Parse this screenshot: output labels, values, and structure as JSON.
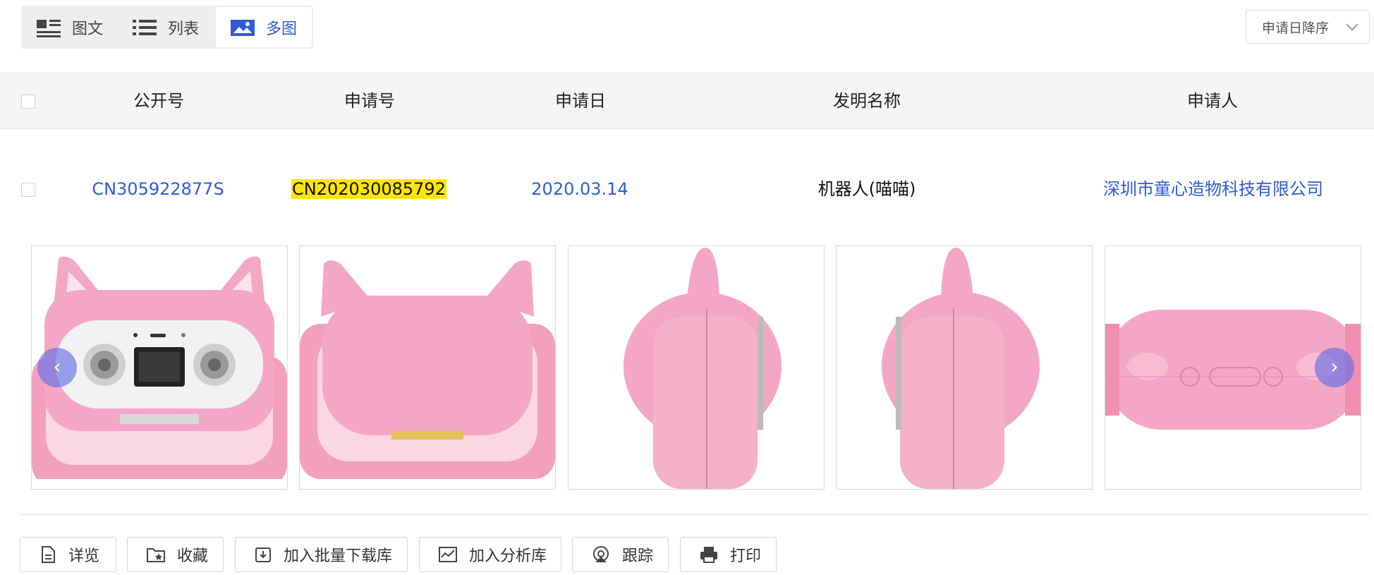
{
  "view_toggle": {
    "items": [
      {
        "label": "图文",
        "icon": "image-text-icon"
      },
      {
        "label": "列表",
        "icon": "list-icon"
      },
      {
        "label": "多图",
        "icon": "multi-image-icon",
        "active": true
      }
    ]
  },
  "sort": {
    "label": "申请日降序"
  },
  "table": {
    "headers": [
      "公开号",
      "申请号",
      "申请日",
      "发明名称",
      "申请人"
    ],
    "row": {
      "publication_no": "CN305922877S",
      "application_no": "CN202030085792",
      "application_date": "2020.03.14",
      "title": "机器人(喵喵)",
      "applicant": "深圳市童心造物科技有限公司"
    }
  },
  "images": {
    "count": 5,
    "descriptions": [
      "front view",
      "rear view",
      "left view",
      "right view",
      "top view"
    ],
    "colors": {
      "body": "#f4a7c4",
      "face": "#f2f2f2",
      "screen": "#222222"
    }
  },
  "actions": [
    {
      "label": "详览",
      "icon": "document-icon"
    },
    {
      "label": "收藏",
      "icon": "folder-star-icon"
    },
    {
      "label": "加入批量下载库",
      "icon": "download-icon"
    },
    {
      "label": "加入分析库",
      "icon": "chart-icon"
    },
    {
      "label": "跟踪",
      "icon": "track-icon"
    },
    {
      "label": "打印",
      "icon": "printer-icon"
    }
  ],
  "colors": {
    "link": "#2f5bd6",
    "highlight": "#ffe600",
    "arrow": "#646ee6"
  }
}
